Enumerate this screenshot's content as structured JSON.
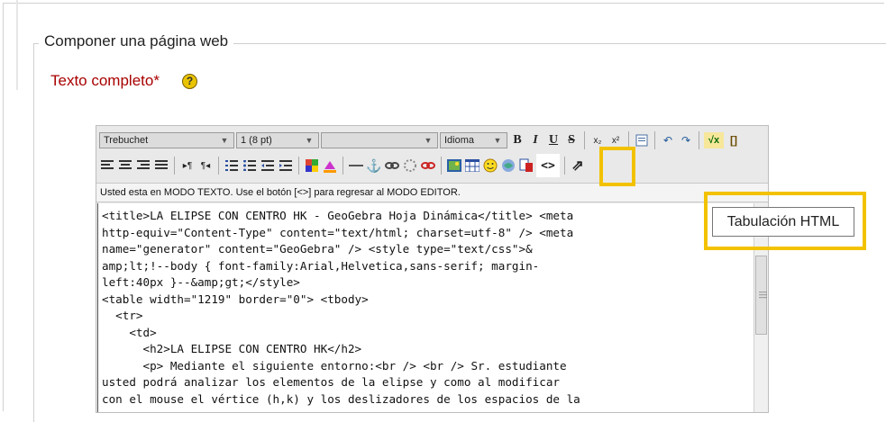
{
  "section": {
    "legend": "Componer una página web"
  },
  "field": {
    "label": "Texto completo*",
    "help_glyph": "?"
  },
  "toolbar": {
    "font_family": "Trebuchet",
    "font_size": "1 (8 pt)",
    "format": "",
    "language": "Idioma",
    "bold": "B",
    "italic": "I",
    "underline": "U",
    "strike": "S",
    "subscript": "x₂",
    "superscript": "x²",
    "undo": "↶",
    "redo": "↷",
    "math": "√x",
    "brackets": "[]",
    "html_toggle": "<>",
    "fullscreen": "⇗"
  },
  "status_bar": "Usted esta en MODO TEXTO. Use el botón [<>] para regresar al MODO EDITOR.",
  "tooltip": "Tabulación HTML",
  "source_text": "<title>LA ELIPSE CON CENTRO HK - GeoGebra Hoja Dinámica</title> <meta\nhttp-equiv=\"Content-Type\" content=\"text/html; charset=utf-8\" /> <meta\nname=\"generator\" content=\"GeoGebra\" /> <style type=\"text/css\">&\namp;lt;!--body { font-family:Arial,Helvetica,sans-serif; margin-\nleft:40px }--&amp;gt;</style>\n<table width=\"1219\" border=\"0\"> <tbody>\n  <tr>\n    <td>\n      <h2>LA ELIPSE CON CENTRO HK</h2>\n      <p> Mediante el siguiente entorno:<br /> <br /> Sr. estudiante\nusted podrá analizar los elementos de la elipse y como al modificar\ncon el mouse el vértice (h,k) y los deslizadores de los espacios de la",
  "colors": {
    "highlight": "#f2c200",
    "label_red": "#a80000"
  }
}
